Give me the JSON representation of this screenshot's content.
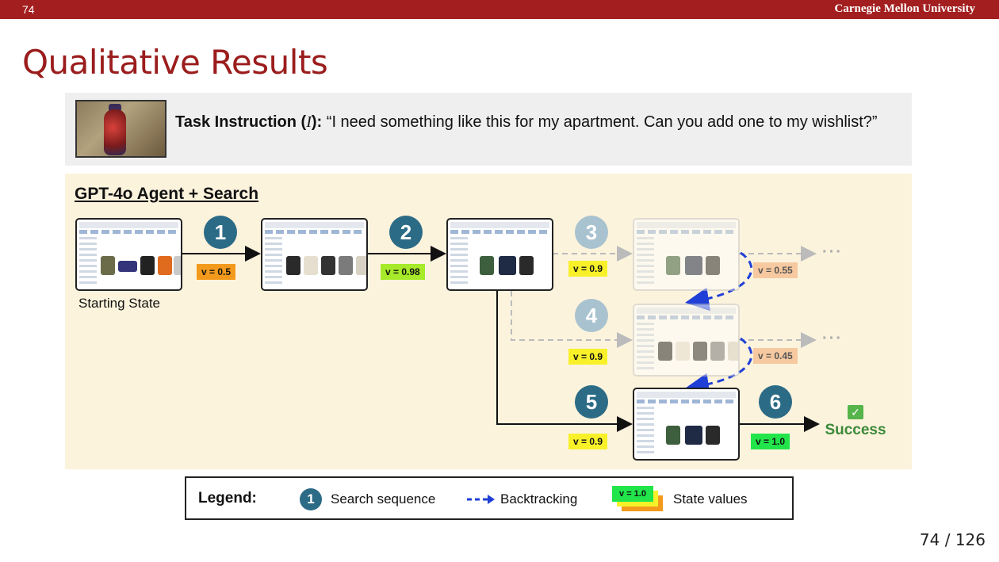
{
  "header": {
    "slide_number": "74",
    "brand": "Carnegie Mellon University"
  },
  "title": "Qualitative Results",
  "instruction": {
    "label": "Task Instruction (",
    "symbol": "I",
    "label_end": "):",
    "text": "“I need something like this for my apartment. Can you add one to my wishlist?”"
  },
  "panel": {
    "title": "GPT-4o Agent + Search",
    "starting_state_label": "Starting State",
    "steps": [
      {
        "number": "1",
        "value": "v = 0.5"
      },
      {
        "number": "2",
        "value": "v = 0.98"
      },
      {
        "number": "3",
        "value": "v = 0.9"
      },
      {
        "number": "4",
        "value": "v = 0.9"
      },
      {
        "number": "5",
        "value": "v = 0.9"
      },
      {
        "number": "6",
        "value": "v = 1.0"
      }
    ],
    "pruned_values": [
      "v = 0.55",
      "v = 0.45"
    ],
    "ellipsis": "···",
    "success": {
      "check": "✓",
      "label": "Success"
    }
  },
  "legend": {
    "title": "Legend:",
    "badge": "1",
    "search_sequence": "Search sequence",
    "backtracking": "Backtracking",
    "state_value": "v = 1.0",
    "state_values": "State values"
  },
  "pagination": "74 / 126",
  "colors": {
    "header_bar": "#a31f1f",
    "title": "#9b1c1c",
    "badge": "#2c6b86",
    "backtrack": "#1f3fd6",
    "panel_bg": "#fcf3dd"
  }
}
